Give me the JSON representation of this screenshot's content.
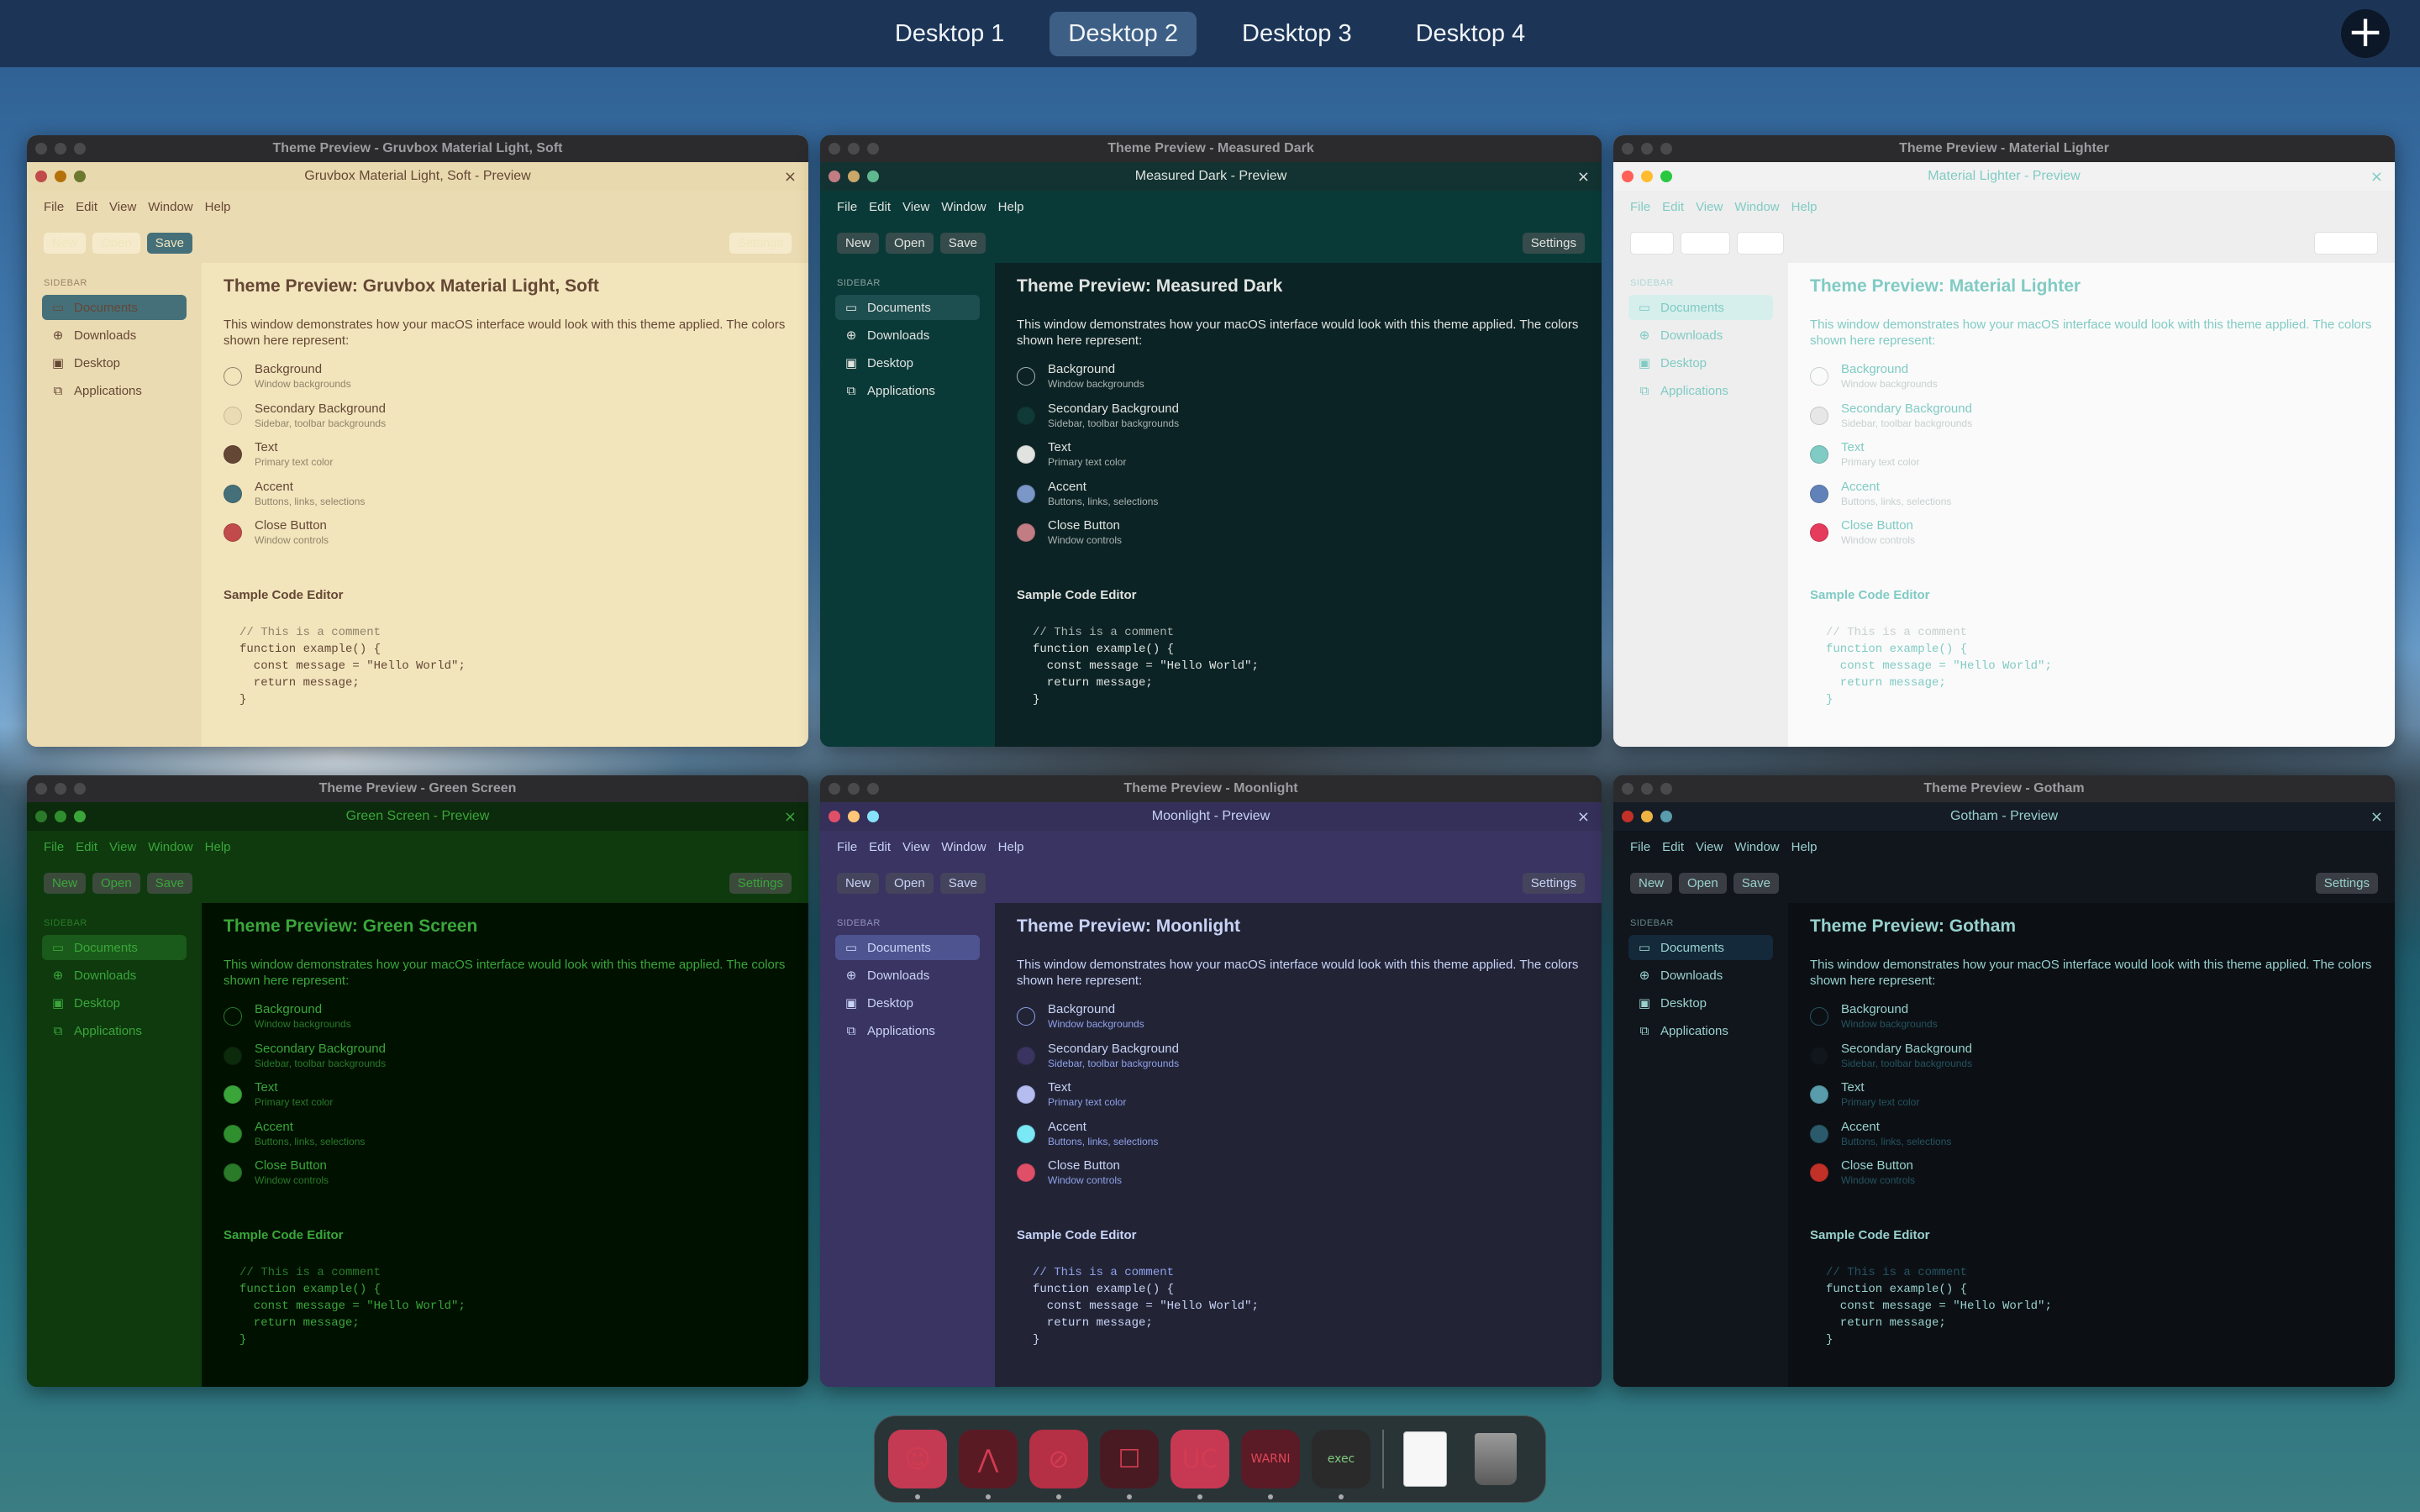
{
  "top_bar": {
    "desktops": [
      "Desktop 1",
      "Desktop 2",
      "Desktop 3",
      "Desktop 4"
    ],
    "active_index": 1,
    "add_icon": "plus-icon"
  },
  "common": {
    "menus": [
      "File",
      "Edit",
      "View",
      "Window",
      "Help"
    ],
    "toolbar": {
      "new": "New",
      "open": "Open",
      "save": "Save",
      "settings": "Settings"
    },
    "sidebar_heading": "SIDEBAR",
    "sidebar_items": [
      {
        "label": "Documents",
        "icon": "folder-icon"
      },
      {
        "label": "Downloads",
        "icon": "download-icon"
      },
      {
        "label": "Desktop",
        "icon": "monitor-icon"
      },
      {
        "label": "Applications",
        "icon": "app-icon"
      }
    ],
    "intro": "This window demonstrates how your macOS interface would look with this theme applied. The colors shown here represent:",
    "roles": [
      {
        "name": "Background",
        "desc": "Window backgrounds"
      },
      {
        "name": "Secondary Background",
        "desc": "Sidebar, toolbar backgrounds"
      },
      {
        "name": "Text",
        "desc": "Primary text color"
      },
      {
        "name": "Accent",
        "desc": "Buttons, links, selections"
      },
      {
        "name": "Close Button",
        "desc": "Window controls"
      }
    ],
    "code_title": "Sample Code Editor",
    "code_lines": [
      "// This is a comment",
      "function example() {",
      "  const message = \"Hello World\";",
      "  return message;",
      "}"
    ]
  },
  "windows": [
    {
      "outer_title": "Theme Preview - Gruvbox Material Light, Soft",
      "inner_title": "Gruvbox Material Light, Soft - Preview",
      "heading": "Theme Preview: Gruvbox Material Light, Soft",
      "colors": {
        "bg": "#f2e5bc",
        "bg2": "#ebdbb2",
        "text": "#654735",
        "accent": "#45707a",
        "close": "#c14a4a",
        "titlebar": "#e8d9ae",
        "comment": "#8f8469",
        "btn": "#f5ebcc"
      },
      "swatches": [
        "#f2e5bc",
        "#ebdbb2",
        "#654735",
        "#45707a",
        "#c14a4a"
      ]
    },
    {
      "outer_title": "Theme Preview - Measured Dark",
      "inner_title": "Measured Dark - Preview",
      "heading": "Theme Preview: Measured Dark",
      "colors": {
        "bg": "#0c2325",
        "bg2": "#0a3a38",
        "text": "#e0e3e0",
        "accent": "#1d4e50",
        "close": "#c27c84",
        "titlebar": "#123331",
        "comment": "#a9b3b0",
        "btn": "#364b4b"
      },
      "swatches": [
        "#0c2325",
        "#0f3a37",
        "#e0e3e0",
        "#7a97c7",
        "#c27c84"
      ]
    },
    {
      "outer_title": "Theme Preview - Material Lighter",
      "inner_title": "Material Lighter - Preview",
      "heading": "Theme Preview: Material Lighter",
      "colors": {
        "bg": "#fafafa",
        "bg2": "#eeeeee",
        "text": "#80cbc4",
        "accent": "#d6efec",
        "close": "#e53935",
        "titlebar": "#f2f2f2",
        "comment": "#c7d0d0",
        "btn": "#ffffff"
      },
      "swatches": [
        "#fafafa",
        "#e7e7e7",
        "#80cbc4",
        "#6182b8",
        "#e53b5c"
      ]
    },
    {
      "outer_title": "Theme Preview - Green Screen",
      "inner_title": "Green Screen - Preview",
      "heading": "Theme Preview: Green Screen",
      "colors": {
        "bg": "#001100",
        "bg2": "#0e3a0e",
        "text": "#3aa63a",
        "accent": "#1a5a1a",
        "close": "#2a7a2a",
        "titlebar": "#0c2a0c",
        "comment": "#2a7a2a",
        "btn": "#3c4a3c"
      },
      "swatches": [
        "#001100",
        "#0c2a0c",
        "#3aa63a",
        "#2f8f2f",
        "#2a7a2a"
      ]
    },
    {
      "outer_title": "Theme Preview - Moonlight",
      "inner_title": "Moonlight - Preview",
      "heading": "Theme Preview: Moonlight",
      "colors": {
        "bg": "#222436",
        "bg2": "#3a3462",
        "text": "#c8d3f5",
        "accent": "#4e5490",
        "close": "#e04f68",
        "titlebar": "#34305a",
        "comment": "#8fa0e8",
        "btn": "#44445c"
      },
      "swatches": [
        "#222436",
        "#3a3560",
        "#b4bcf0",
        "#7ae8f5",
        "#e04f68"
      ]
    },
    {
      "outer_title": "Theme Preview - Gotham",
      "inner_title": "Gotham - Preview",
      "heading": "Theme Preview: Gotham",
      "colors": {
        "bg": "#0c1014",
        "bg2": "#11151c",
        "text": "#98d1ce",
        "accent": "#14293a",
        "close": "#c23127",
        "titlebar": "#161c26",
        "comment": "#245361",
        "btn": "#3a3e44"
      },
      "swatches": [
        "#0c1014",
        "#11151c",
        "#599cab",
        "#2b5b6b",
        "#c23127"
      ]
    }
  ],
  "dock": {
    "apps": [
      {
        "name": "finder-icon",
        "glyph": "☺",
        "bg": "#c43a52"
      },
      {
        "name": "atom-icon",
        "glyph": "⋀",
        "bg": "#5a1a24"
      },
      {
        "name": "safari-icon",
        "glyph": "⊘",
        "bg": "#b52f45"
      },
      {
        "name": "robot-icon",
        "glyph": "☐",
        "bg": "#4a1a22"
      },
      {
        "name": "calendar-app-icon",
        "glyph": "UC",
        "bg": "#c73853"
      },
      {
        "name": "console-icon",
        "glyph": "WARNI",
        "bg": "#5a1a26"
      },
      {
        "name": "terminal-icon",
        "glyph": "exec",
        "bg": "#2a2a2a"
      },
      {
        "name": "document-icon",
        "glyph": "",
        "bg": "#f5f5f5"
      },
      {
        "name": "trash-icon",
        "glyph": "",
        "bg": "#3a3a3a"
      }
    ]
  }
}
